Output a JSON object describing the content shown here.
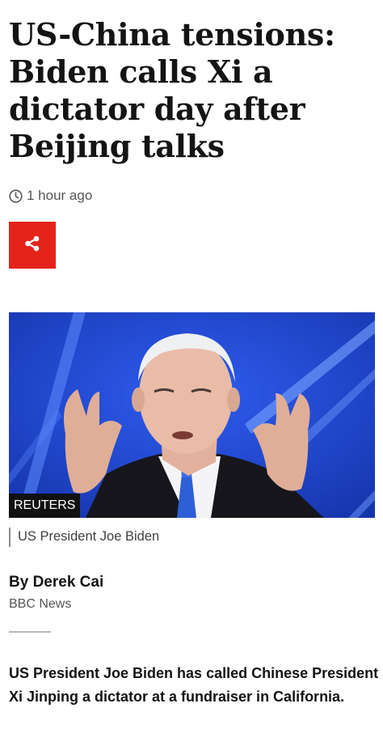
{
  "article": {
    "headline": "US-China tensions: Biden calls Xi a dictator day after Beijing talks",
    "timestamp": "1 hour ago",
    "image": {
      "credit": "REUTERS",
      "caption": "US President Joe Biden",
      "background_color": "#1f44c9"
    },
    "byline": {
      "author": "By Derek Cai",
      "organization": "BBC News"
    },
    "lede": "US President Joe Biden has called Chinese President Xi Jinping a dictator at a fundraiser in California."
  },
  "icons": {
    "clock": "clock-icon",
    "share": "share-icon"
  },
  "colors": {
    "share_button": "#e4231b",
    "text": "#141414",
    "meta_text": "#545658"
  }
}
